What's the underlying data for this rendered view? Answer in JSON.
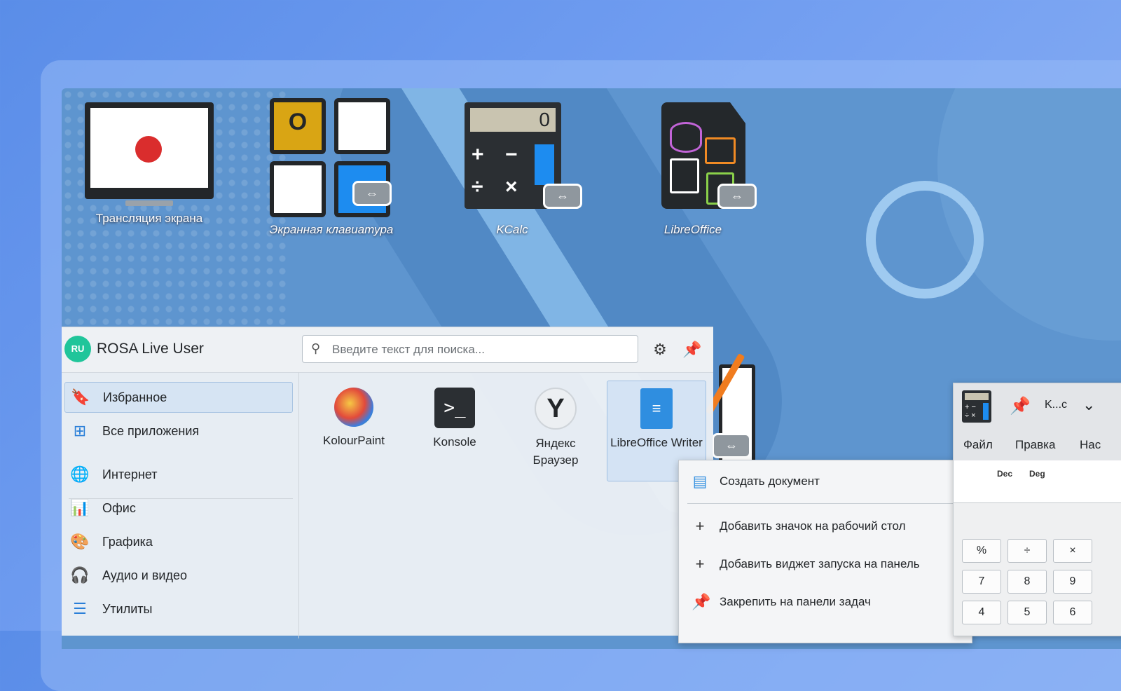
{
  "desktop": {
    "icons": [
      {
        "label": "Трансляция экрана",
        "italic": false
      },
      {
        "label": "Экранная клавиатура",
        "italic": true
      },
      {
        "label": "KCalc",
        "italic": true
      },
      {
        "label": "LibreOffice",
        "italic": true
      }
    ]
  },
  "menu": {
    "avatar": "RU",
    "user": "ROSA Live User",
    "search_placeholder": "Введите текст для поиска...",
    "categories": [
      {
        "label": "Избранное",
        "active": true
      },
      {
        "label": "Все приложения"
      },
      {
        "label": "Интернет"
      },
      {
        "label": "Офис"
      },
      {
        "label": "Графика"
      },
      {
        "label": "Аудио и видео"
      },
      {
        "label": "Утилиты"
      }
    ],
    "apps": [
      {
        "name": "KolourPaint"
      },
      {
        "name": "Konsole"
      },
      {
        "name": "Яндекс Браузер"
      },
      {
        "name": "LibreOffice Writer",
        "selected": true
      }
    ]
  },
  "context_menu": {
    "items": [
      {
        "label": "Создать документ",
        "icon": "document-icon"
      },
      {
        "label": "Добавить значок на рабочий стол",
        "icon": "plus-icon"
      },
      {
        "label": "Добавить виджет запуска на панель",
        "icon": "plus-icon"
      },
      {
        "label": "Закрепить на панели задач",
        "icon": "pin-icon"
      }
    ]
  },
  "kcalc": {
    "title": "K...c",
    "menus": [
      "Файл",
      "Правка",
      "Нас"
    ],
    "modes": [
      "Dec",
      "Deg"
    ],
    "buttons": [
      [
        "%",
        "÷",
        "×"
      ],
      [
        "7",
        "8",
        "9"
      ],
      [
        "4",
        "5",
        "6"
      ]
    ]
  },
  "colors": {
    "accent": "#3daee9",
    "avatar": "#20c59a",
    "desktop": "#5e95cf"
  }
}
